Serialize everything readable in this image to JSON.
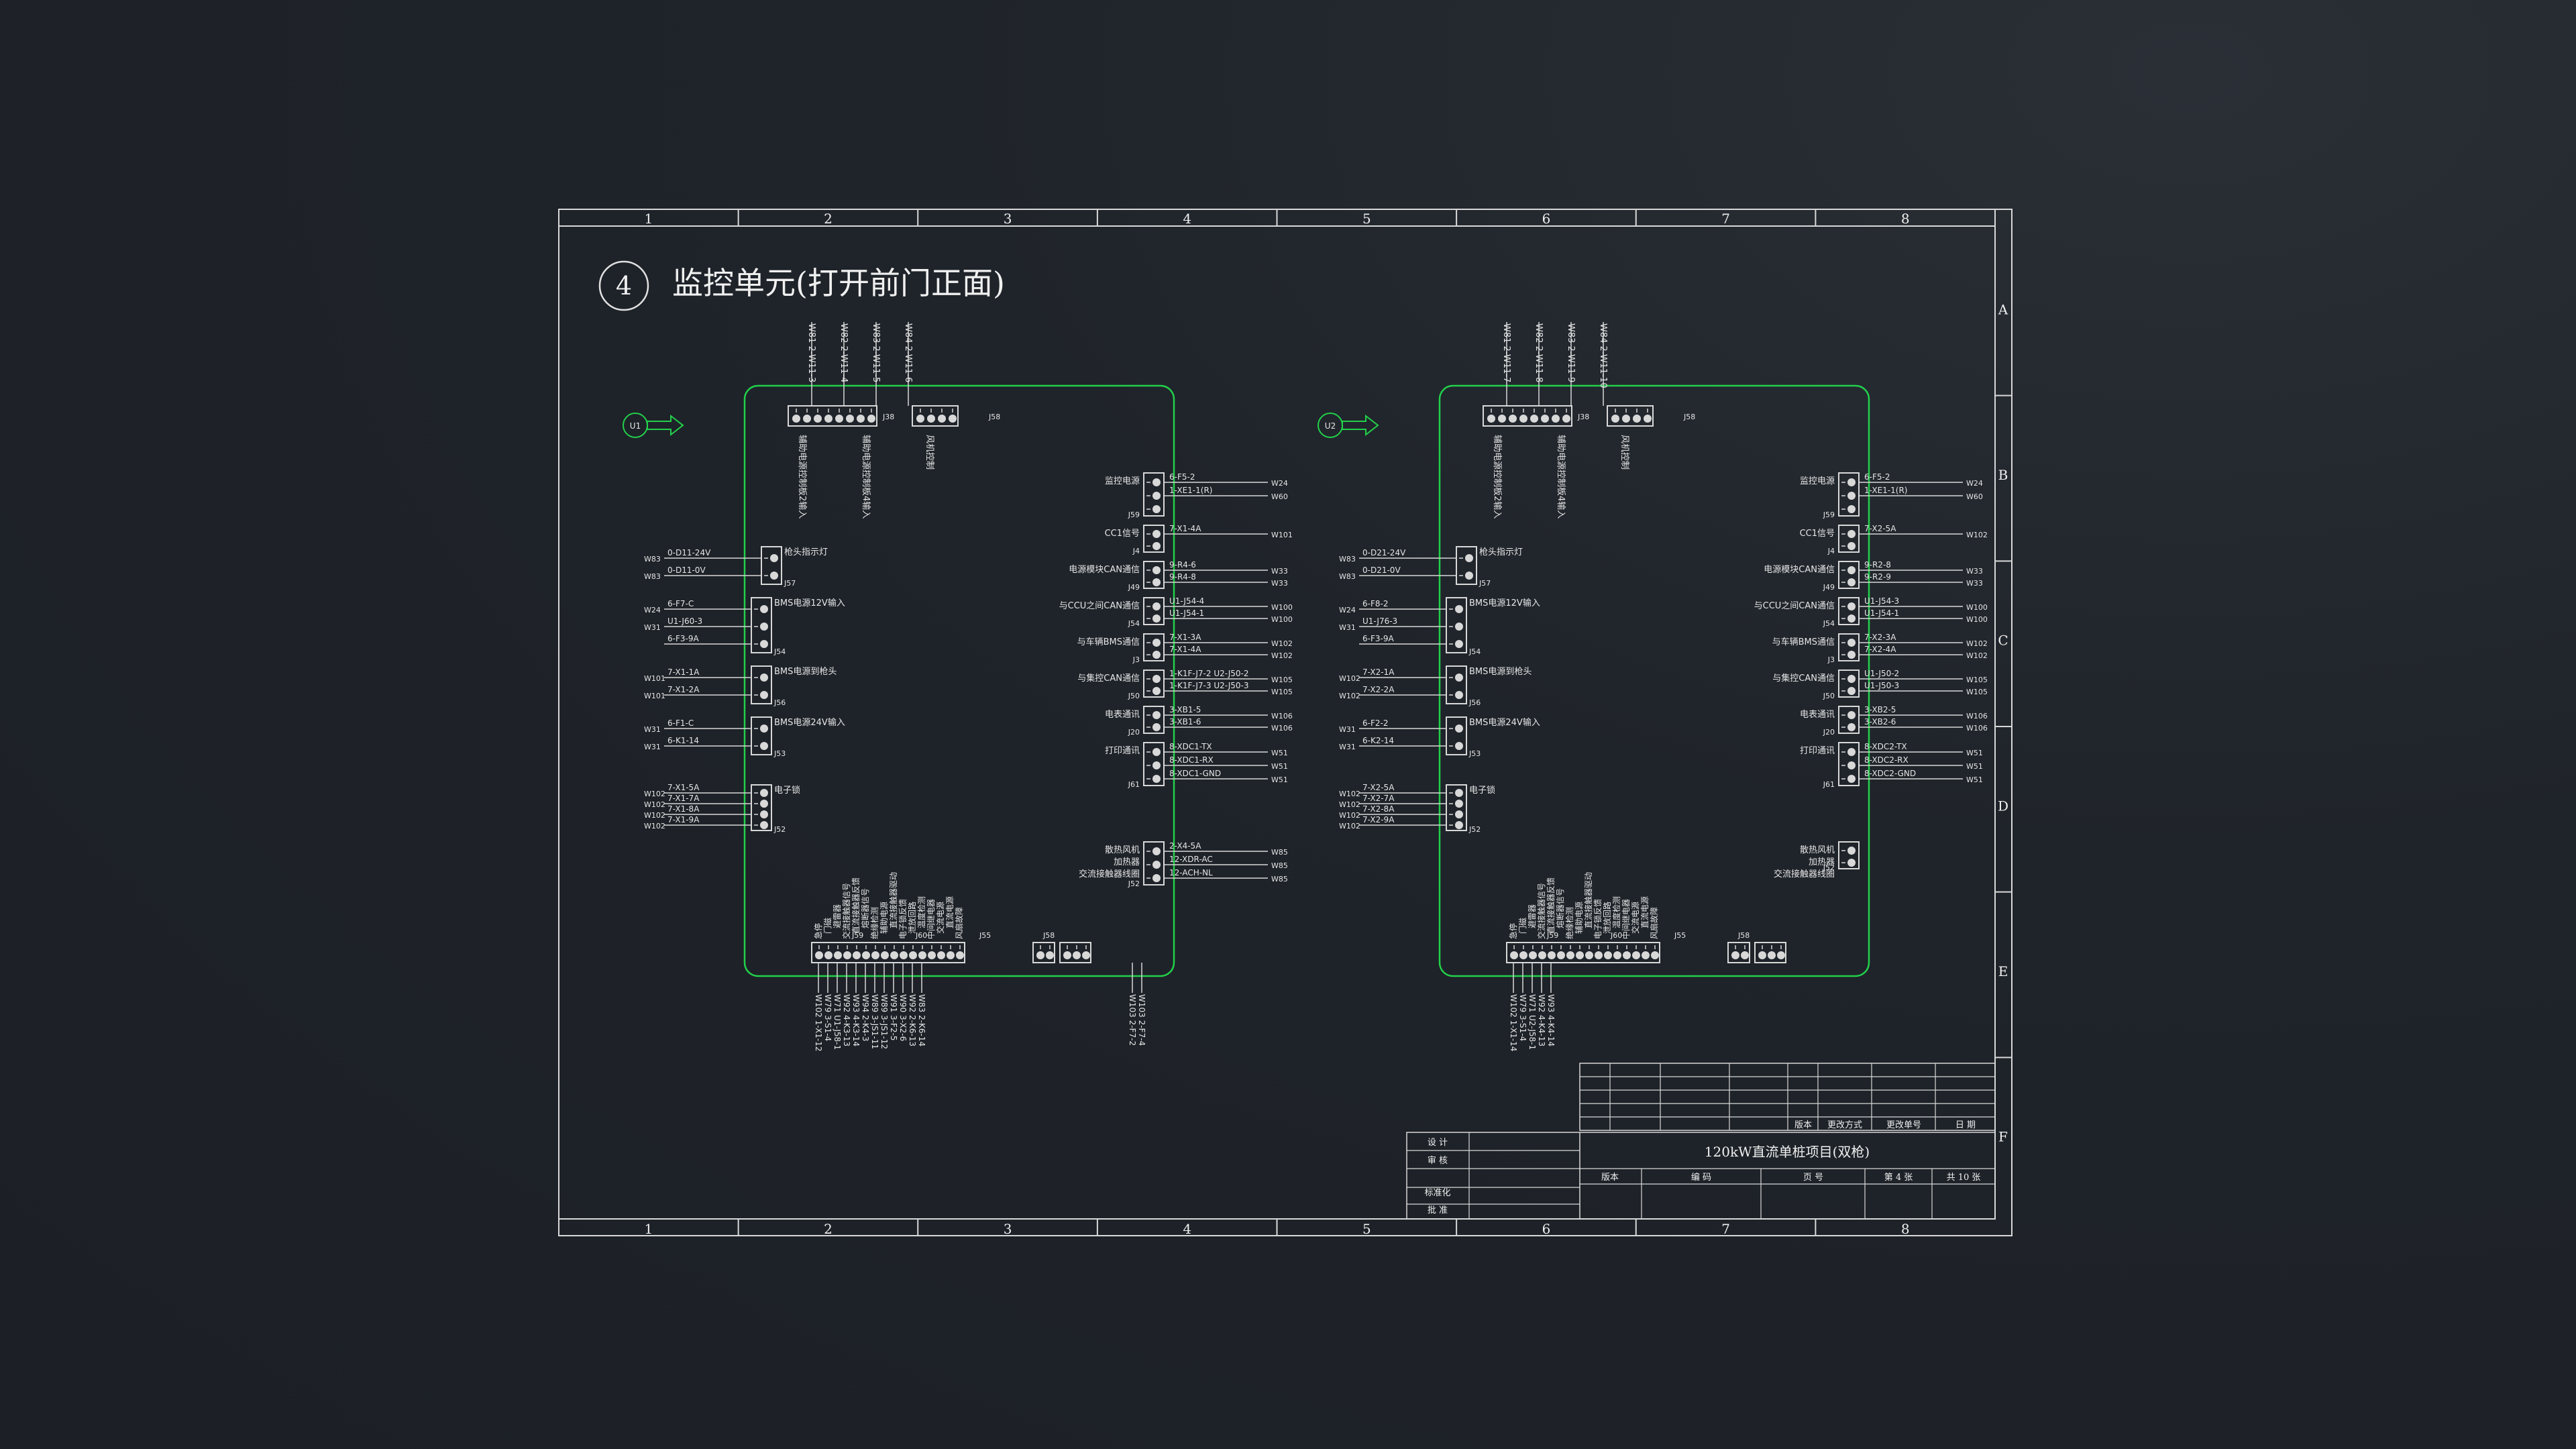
{
  "colors": {
    "background": "#1e2329",
    "frame": "#d8d8d8",
    "board": "#22d04a",
    "magenta": "#d83cd8",
    "text": "#e6e6e6"
  },
  "drawing": {
    "section_number": "4",
    "title": "监控单元(打开前门正面)",
    "columns": [
      "1",
      "2",
      "3",
      "4",
      "5",
      "6",
      "7",
      "8"
    ],
    "rows": [
      "A",
      "B",
      "C",
      "D",
      "E",
      "F"
    ]
  },
  "boards": [
    {
      "id": "board-1",
      "marker": "U1",
      "top_cable_labels": [
        "W81 2-W11-3",
        "W82 2-W11-4",
        "W83 2-W11-5",
        "W84 2-W11-6"
      ],
      "top_connector_labels": [
        "辅助电源控制板2输入",
        "辅助电源控制板4输入",
        "风机控制"
      ],
      "top_conn_ids": [
        "J38",
        "J58"
      ],
      "left_connectors": [
        {
          "id": "J57",
          "name": "枪头指示灯",
          "wires": [
            [
              "W83",
              "0-D11-24V"
            ],
            [
              "W83",
              "0-D11-0V"
            ]
          ]
        },
        {
          "id": "J54",
          "name": "BMS电源12V输入",
          "wires": [
            [
              "W24",
              "6-F7-C"
            ],
            [
              "W31",
              "U1-J60-3"
            ],
            [
              "",
              "6-F3-9A"
            ]
          ]
        },
        {
          "id": "J56",
          "name": "BMS电源到枪头",
          "wires": [
            [
              "W101",
              "7-X1-1A"
            ],
            [
              "W101",
              "7-X1-2A"
            ]
          ]
        },
        {
          "id": "J53",
          "name": "BMS电源24V输入",
          "wires": [
            [
              "W31",
              "6-F1-C"
            ],
            [
              "W31",
              "6-K1-14"
            ]
          ]
        },
        {
          "id": "J52",
          "name": "电子锁",
          "wires": [
            [
              "W102",
              "7-X1-5A"
            ],
            [
              "W102",
              "7-X1-7A"
            ],
            [
              "W102",
              "7-X1-8A"
            ],
            [
              "W102",
              "7-X1-9A"
            ]
          ]
        }
      ],
      "right_connectors": [
        {
          "id": "J59",
          "name": "监控电源",
          "wires": [
            [
              "6-F5-2",
              "W24"
            ],
            [
              "1-XE1-1(R)",
              "W60"
            ]
          ]
        },
        {
          "id": "J4",
          "name": "CC1信号",
          "wires": [
            [
              "7-X1-4A",
              "W101"
            ]
          ]
        },
        {
          "id": "J49",
          "name": "电源模块CAN通信",
          "wires": [
            [
              "9-R4-6",
              "W33"
            ],
            [
              "9-R4-8",
              "W33"
            ]
          ]
        },
        {
          "id": "J54",
          "name": "与CCU之间CAN通信",
          "wires": [
            [
              "U1-J54-4",
              "W100"
            ],
            [
              "U1-J54-1",
              "W100"
            ]
          ]
        },
        {
          "id": "J3",
          "name": "与车辆BMS通信",
          "wires": [
            [
              "7-X1-3A",
              "W102"
            ],
            [
              "7-X1-4A",
              "W102"
            ]
          ]
        },
        {
          "id": "J50",
          "name": "与集控CAN通信",
          "wires": [
            [
              "1-K1F-J7-2 U2-J50-2",
              "W105"
            ],
            [
              "1-K1F-J7-3 U2-J50-3",
              "W105"
            ]
          ]
        },
        {
          "id": "J20",
          "name": "电表通讯",
          "wires": [
            [
              "3-XB1-5",
              "W106"
            ],
            [
              "3-XB1-6",
              "W106"
            ]
          ]
        },
        {
          "id": "J61",
          "name": "打印通讯",
          "wires": [
            [
              "8-XDC1-TX",
              "W51"
            ],
            [
              "8-XDC1-RX",
              "W51"
            ],
            [
              "8-XDC1-GND",
              "W51"
            ]
          ]
        },
        {
          "id": "J52",
          "name": "散热风机/加热器/交流接触器线圈",
          "wires": [
            [
              "2-X4-5A",
              "W85"
            ],
            [
              "12-XDR-AC",
              "W85"
            ],
            [
              "12-ACH-NL",
              "W85"
            ]
          ]
        }
      ],
      "bottom_labels": [
        "急停",
        "门磁",
        "避雷器",
        "交流接触器信号",
        "直流接触器反馈",
        "熔断器信号",
        "绝缘检测",
        "辅助电源",
        "直流接触器驱动",
        "电子锁反馈",
        "泄放回路",
        "温度检测",
        "中间继电器",
        "交流电源",
        "直流电源",
        "风扇故障"
      ],
      "bottom_ids": [
        "J59",
        "J60",
        "J55",
        "J58"
      ],
      "bottom_wires": [
        "W102 1-X1-12",
        "W79 3-S1-4",
        "W71 U1-J58-1",
        "W92 4-K3-13",
        "W93 4-K3-14",
        "W94 2-K4-3",
        "W89 3-JS1-11",
        "W89 3-JS1-12",
        "W91 3-F2-5",
        "W90 3-X2-6",
        "W92 2-K6-13",
        "W83 2-K6-14",
        "W103 2-F7-2",
        "W103 2-F7-4"
      ]
    },
    {
      "id": "board-2",
      "marker": "U2",
      "top_cable_labels": [
        "W81 2-W11-7",
        "W82 2-W11-8",
        "W83 2-W11-9",
        "W84 2-W11-10"
      ],
      "top_connector_labels": [
        "辅助电源控制板2输入",
        "辅助电源控制板4输入",
        "风机控制"
      ],
      "top_conn_ids": [
        "J38",
        "J58"
      ],
      "left_connectors": [
        {
          "id": "J57",
          "name": "枪头指示灯",
          "wires": [
            [
              "W83",
              "0-D21-24V"
            ],
            [
              "W83",
              "0-D21-0V"
            ]
          ]
        },
        {
          "id": "J54",
          "name": "BMS电源12V输入",
          "wires": [
            [
              "W24",
              "6-F8-2"
            ],
            [
              "W31",
              "U1-J76-3"
            ],
            [
              "",
              "6-F3-9A"
            ]
          ]
        },
        {
          "id": "J56",
          "name": "BMS电源到枪头",
          "wires": [
            [
              "W102",
              "7-X2-1A"
            ],
            [
              "W102",
              "7-X2-2A"
            ]
          ]
        },
        {
          "id": "J53",
          "name": "BMS电源24V输入",
          "wires": [
            [
              "W31",
              "6-F2-2"
            ],
            [
              "W31",
              "6-K2-14"
            ]
          ]
        },
        {
          "id": "J52",
          "name": "电子锁",
          "wires": [
            [
              "W102",
              "7-X2-5A"
            ],
            [
              "W102",
              "7-X2-7A"
            ],
            [
              "W102",
              "7-X2-8A"
            ],
            [
              "W102",
              "7-X2-9A"
            ]
          ]
        }
      ],
      "right_connectors": [
        {
          "id": "J59",
          "name": "监控电源",
          "wires": [
            [
              "6-F5-2",
              "W24"
            ],
            [
              "1-XE1-1(R)",
              "W60"
            ]
          ]
        },
        {
          "id": "J4",
          "name": "CC1信号",
          "wires": [
            [
              "7-X2-5A",
              "W102"
            ]
          ]
        },
        {
          "id": "J49",
          "name": "电源模块CAN通信",
          "wires": [
            [
              "9-R2-8",
              "W33"
            ],
            [
              "9-R2-9",
              "W33"
            ]
          ]
        },
        {
          "id": "J54",
          "name": "与CCU之间CAN通信",
          "wires": [
            [
              "U1-J54-3",
              "W100"
            ],
            [
              "U1-J54-1",
              "W100"
            ]
          ]
        },
        {
          "id": "J3",
          "name": "与车辆BMS通信",
          "wires": [
            [
              "7-X2-3A",
              "W102"
            ],
            [
              "7-X2-4A",
              "W102"
            ]
          ]
        },
        {
          "id": "J50",
          "name": "与集控CAN通信",
          "wires": [
            [
              "U1-J50-2",
              "W105"
            ],
            [
              "U1-J50-3",
              "W105"
            ]
          ]
        },
        {
          "id": "J20",
          "name": "电表通讯",
          "wires": [
            [
              "3-XB2-5",
              "W106"
            ],
            [
              "3-XB2-6",
              "W106"
            ]
          ]
        },
        {
          "id": "J61",
          "name": "打印通讯",
          "wires": [
            [
              "8-XDC2-TX",
              "W51"
            ],
            [
              "8-XDC2-RX",
              "W51"
            ],
            [
              "8-XDC2-GND",
              "W51"
            ]
          ]
        },
        {
          "id": "J52",
          "name": "散热风机/加热器/交流接触器线圈",
          "wires": []
        }
      ],
      "bottom_labels": [
        "急停",
        "门磁",
        "避雷器",
        "交流接触器信号",
        "直流接触器反馈",
        "熔断器信号",
        "绝缘检测",
        "辅助电源",
        "直流接触器驱动",
        "电子锁反馈",
        "泄放回路",
        "温度检测",
        "中间继电器",
        "交流电源",
        "直流电源",
        "风扇故障"
      ],
      "bottom_ids": [
        "J59",
        "J60",
        "J55",
        "J58"
      ],
      "bottom_wires": [
        "W102 1-X1-14",
        "W79 3-S1-4",
        "W71 U2-J58-1",
        "W92 4-K4-13",
        "W93 4-K4-14"
      ]
    }
  ],
  "title_block": {
    "revision_headers": [
      "版本",
      "更改方式",
      "更改单号",
      "日 期"
    ],
    "role_labels": [
      "设 计",
      "审 核",
      "标准化",
      "批 准"
    ],
    "project_title": "120kW直流单桩项目(双枪)",
    "bottom_fields": [
      "版本",
      "编 码",
      "页 号",
      "第 4 张",
      "共 10 张"
    ]
  }
}
